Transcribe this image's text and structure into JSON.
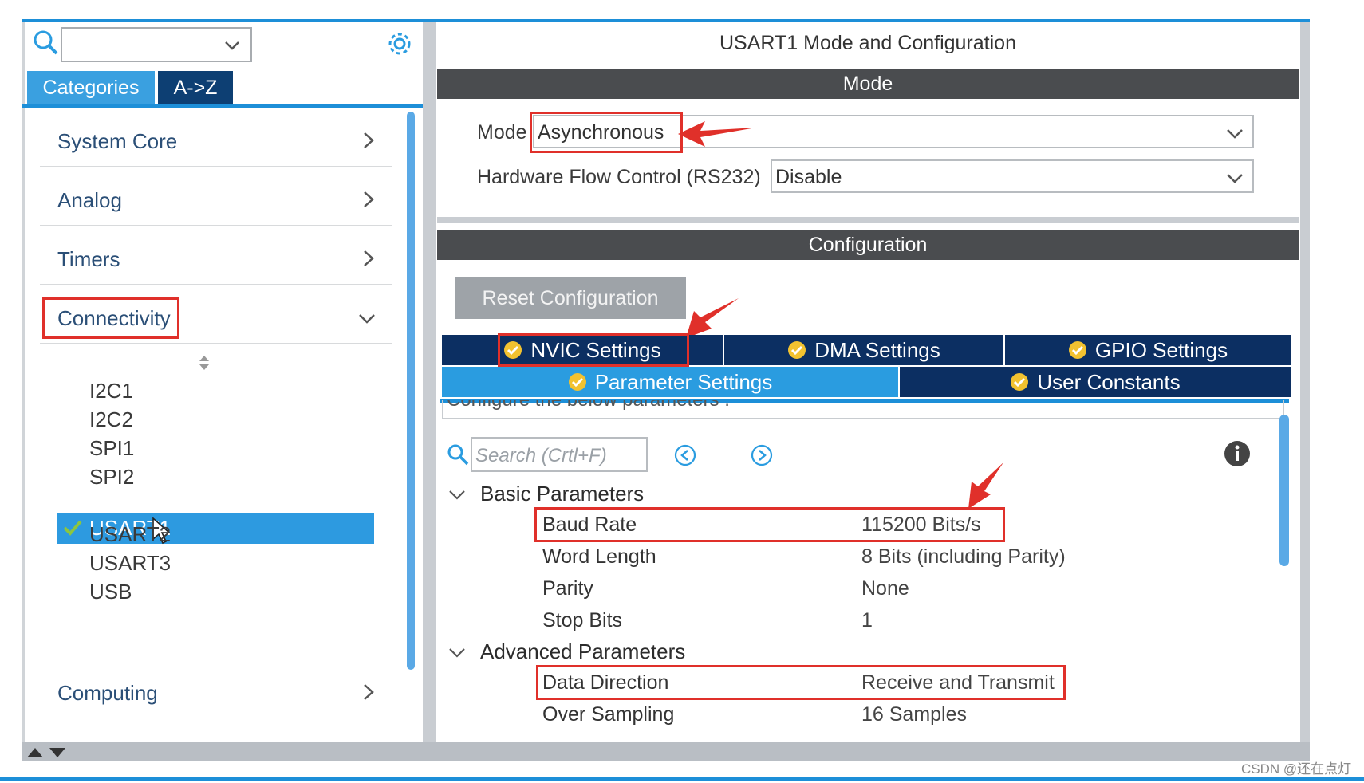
{
  "left": {
    "tabs": {
      "categories": "Categories",
      "az": "A->Z"
    },
    "categories": [
      {
        "label": "System Core"
      },
      {
        "label": "Analog"
      },
      {
        "label": "Timers"
      },
      {
        "label": "Connectivity"
      },
      {
        "label": "Computing"
      }
    ],
    "peripherals": [
      "I2C1",
      "I2C2",
      "SPI1",
      "SPI2",
      "USART1",
      "USART2",
      "USART3",
      "USB"
    ],
    "selected": "USART1"
  },
  "right": {
    "title": "USART1 Mode and Configuration",
    "mode_header": "Mode",
    "mode_label": "Mode",
    "mode_value": "Asynchronous",
    "flow_label": "Hardware Flow Control (RS232)",
    "flow_value": "Disable",
    "config_header": "Configuration",
    "reset_button": "Reset Configuration",
    "tabs": {
      "nvic": "NVIC Settings",
      "dma": "DMA Settings",
      "gpio": "GPIO Settings",
      "param": "Parameter Settings",
      "user": "User Constants"
    },
    "clipped_text": "Configure the below parameters :",
    "search_placeholder": "Search (Crtl+F)",
    "groups": {
      "basic": "Basic Parameters",
      "advanced": "Advanced Parameters"
    },
    "basic_params": [
      {
        "name": "Baud Rate",
        "value": "115200 Bits/s"
      },
      {
        "name": "Word Length",
        "value": "8 Bits (including Parity)"
      },
      {
        "name": "Parity",
        "value": "None"
      },
      {
        "name": "Stop Bits",
        "value": "1"
      }
    ],
    "advanced_params": [
      {
        "name": "Data Direction",
        "value": "Receive and Transmit"
      },
      {
        "name": "Over Sampling",
        "value": "16 Samples"
      }
    ]
  },
  "watermark": "CSDN @还在点灯",
  "colors": {
    "accent": "#1d8fd8",
    "tab_dark": "#0c2f62",
    "tab_active": "#2a9ce0",
    "annotation": "#e0302a",
    "ok_green": "#8cc63f"
  }
}
